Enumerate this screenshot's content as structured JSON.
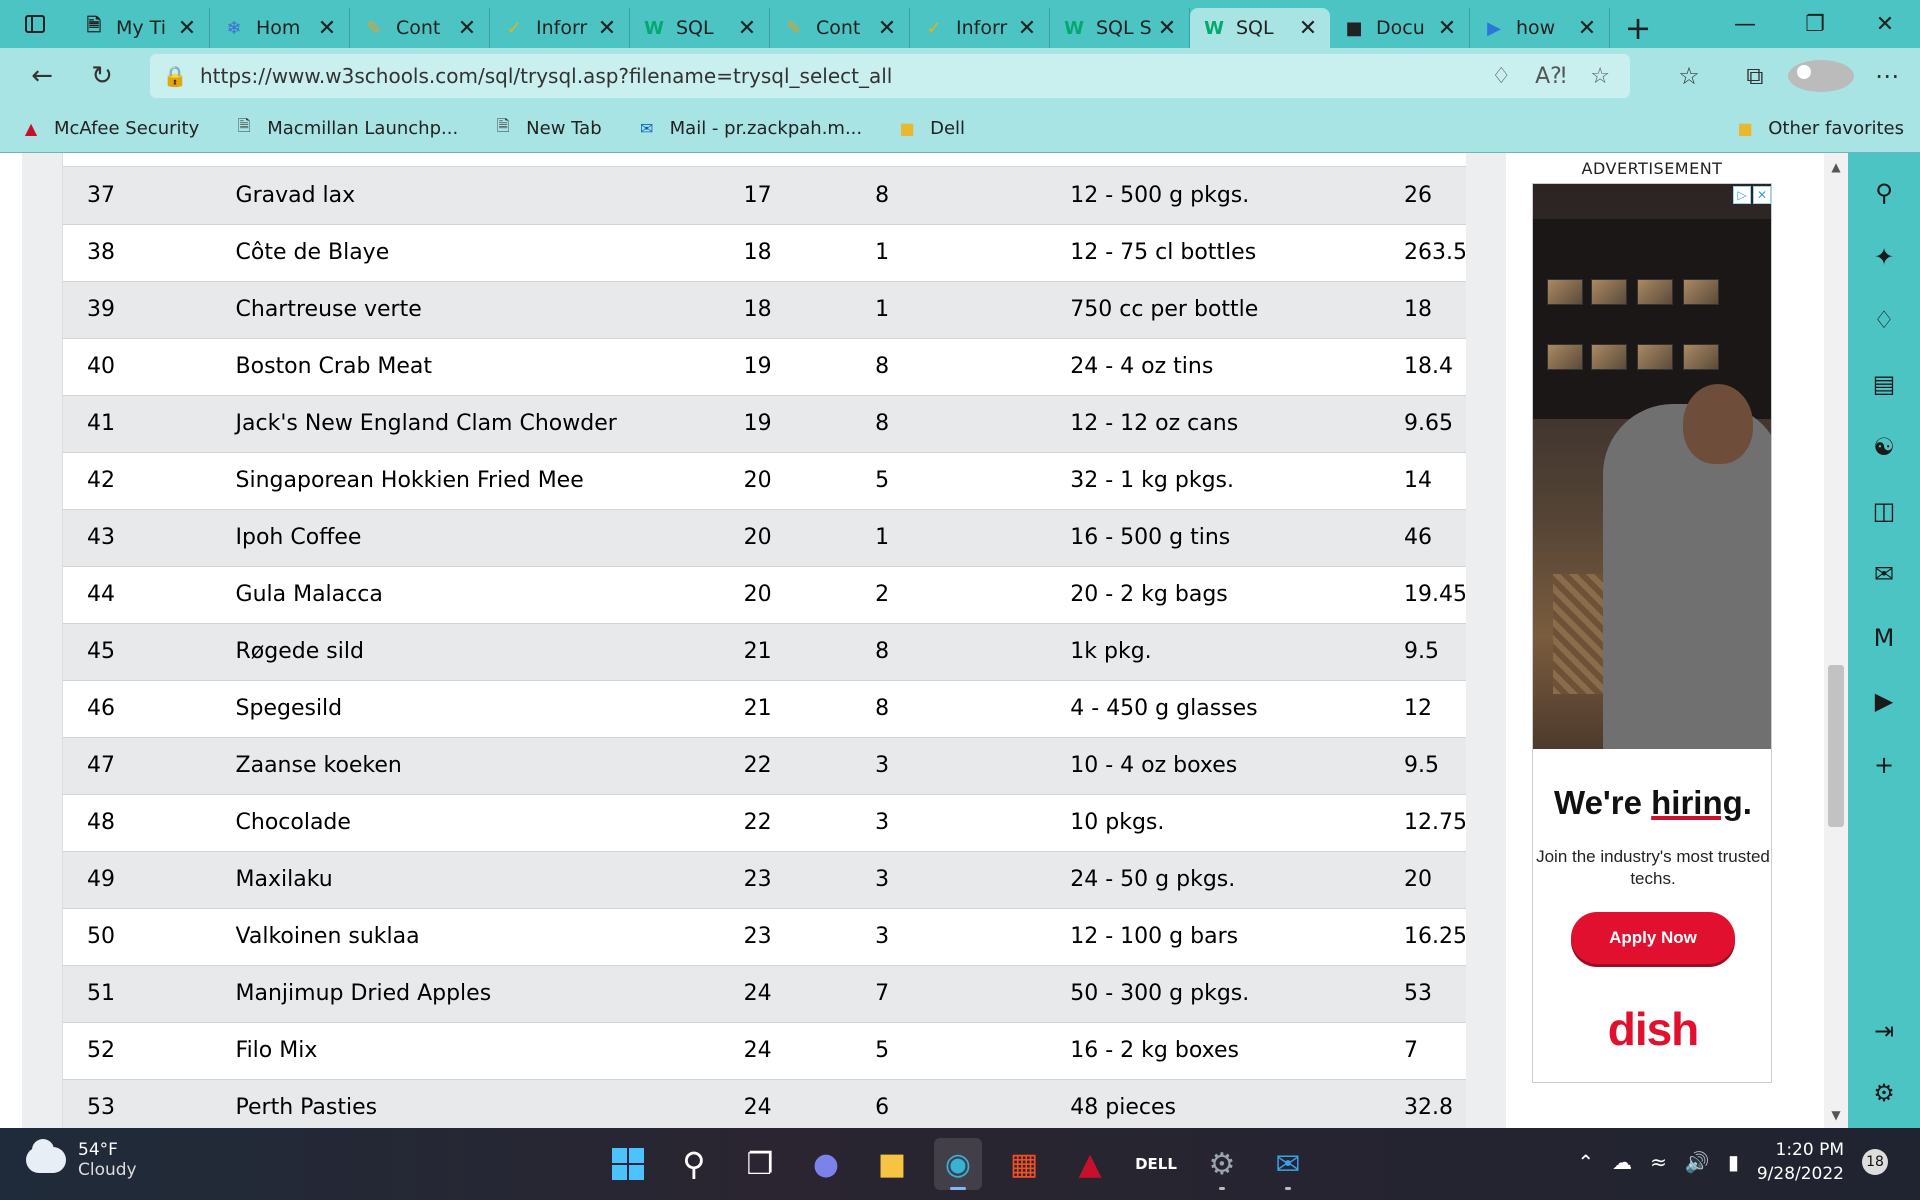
{
  "browser": {
    "tabs": [
      {
        "title": "My Ti",
        "icon": "document-icon"
      },
      {
        "title": "Hom",
        "icon": "snowflake-icon"
      },
      {
        "title": "Cont",
        "icon": "pencil-icon"
      },
      {
        "title": "Inforr",
        "icon": "checkmark-icon"
      },
      {
        "title": "SQL",
        "icon": "w3schools-icon"
      },
      {
        "title": "Cont",
        "icon": "pencil-icon"
      },
      {
        "title": "Inforr",
        "icon": "checkmark-icon"
      },
      {
        "title": "SQL S",
        "icon": "w3schools-icon"
      },
      {
        "title": "SQL",
        "icon": "w3schools-icon",
        "active": true
      },
      {
        "title": "Docu",
        "icon": "document-app-icon"
      },
      {
        "title": "how",
        "icon": "bing-icon"
      }
    ],
    "url": "https://www.w3schools.com/sql/trysql.asp?filename=trysql_select_all",
    "favorites": [
      {
        "label": "McAfee Security",
        "icon": "mcafee-icon"
      },
      {
        "label": "Macmillan Launchp...",
        "icon": "page-icon"
      },
      {
        "label": "New Tab",
        "icon": "page-icon"
      },
      {
        "label": "Mail - pr.zackpah.m...",
        "icon": "outlook-icon"
      },
      {
        "label": "Dell",
        "icon": "folder-icon"
      }
    ],
    "other_favorites": "Other favorites"
  },
  "table": {
    "rows": [
      [
        "37",
        "Gravad lax",
        "17",
        "8",
        "12 - 500 g pkgs.",
        "26"
      ],
      [
        "38",
        "Côte de Blaye",
        "18",
        "1",
        "12 - 75 cl bottles",
        "263.5"
      ],
      [
        "39",
        "Chartreuse verte",
        "18",
        "1",
        "750 cc per bottle",
        "18"
      ],
      [
        "40",
        "Boston Crab Meat",
        "19",
        "8",
        "24 - 4 oz tins",
        "18.4"
      ],
      [
        "41",
        "Jack's New England Clam Chowder",
        "19",
        "8",
        "12 - 12 oz cans",
        "9.65"
      ],
      [
        "42",
        "Singaporean Hokkien Fried Mee",
        "20",
        "5",
        "32 - 1 kg pkgs.",
        "14"
      ],
      [
        "43",
        "Ipoh Coffee",
        "20",
        "1",
        "16 - 500 g tins",
        "46"
      ],
      [
        "44",
        "Gula Malacca",
        "20",
        "2",
        "20 - 2 kg bags",
        "19.45"
      ],
      [
        "45",
        "Røgede sild",
        "21",
        "8",
        "1k pkg.",
        "9.5"
      ],
      [
        "46",
        "Spegesild",
        "21",
        "8",
        "4 - 450 g glasses",
        "12"
      ],
      [
        "47",
        "Zaanse koeken",
        "22",
        "3",
        "10 - 4 oz boxes",
        "9.5"
      ],
      [
        "48",
        "Chocolade",
        "22",
        "3",
        "10 pkgs.",
        "12.75"
      ],
      [
        "49",
        "Maxilaku",
        "23",
        "3",
        "24 - 50 g pkgs.",
        "20"
      ],
      [
        "50",
        "Valkoinen suklaa",
        "23",
        "3",
        "12 - 100 g bars",
        "16.25"
      ],
      [
        "51",
        "Manjimup Dried Apples",
        "24",
        "7",
        "50 - 300 g pkgs.",
        "53"
      ],
      [
        "52",
        "Filo Mix",
        "24",
        "5",
        "16 - 2 kg boxes",
        "7"
      ],
      [
        "53",
        "Perth Pasties",
        "24",
        "6",
        "48 pieces",
        "32.8"
      ]
    ]
  },
  "ad": {
    "label": "ADVERTISEMENT",
    "headline": "We're hiring.",
    "subtext": "Join the industry's most trusted techs.",
    "cta": "Apply Now",
    "brand": "dish"
  },
  "taskbar": {
    "temperature": "54°F",
    "condition": "Cloudy",
    "time": "1:20 PM",
    "date": "9/28/2022",
    "notifications": "18"
  },
  "colors": {
    "chrome": "#4dc4c4",
    "toolbar": "#a8e4e4",
    "row_stripe": "#e7e9eb",
    "ad_red": "#e0102e"
  }
}
